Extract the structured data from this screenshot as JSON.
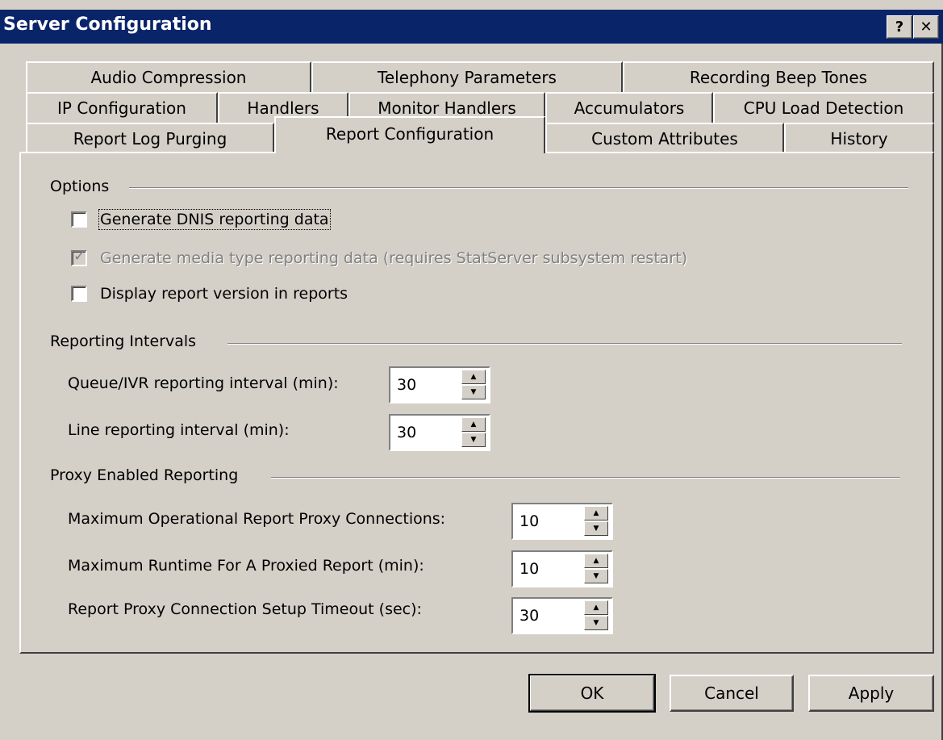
{
  "window": {
    "title": "Server Configuration",
    "help_label": "?",
    "close_label": "✕"
  },
  "tabs": {
    "row1": [
      "Audio Compression",
      "Telephony Parameters",
      "Recording Beep Tones"
    ],
    "row2": [
      "IP Configuration",
      "Handlers",
      "Monitor Handlers",
      "Accumulators",
      "CPU Load Detection"
    ],
    "row3": [
      "Report Log Purging",
      "Report Configuration",
      "Custom Attributes",
      "History"
    ],
    "active": "Report Configuration"
  },
  "options": {
    "group_label": "Options",
    "generate_dnis": {
      "label": "Generate DNIS reporting data",
      "checked": false
    },
    "generate_media": {
      "label": "Generate media type reporting data (requires StatServer subsystem restart)",
      "checked": true,
      "disabled": true
    },
    "display_version": {
      "label": "Display report version in reports",
      "checked": false
    }
  },
  "reporting_intervals": {
    "group_label": "Reporting Intervals",
    "queue_label": "Queue/IVR reporting interval (min):",
    "queue_value": "30",
    "line_label": "Line reporting interval (min):",
    "line_value": "30"
  },
  "proxy": {
    "group_label": "Proxy Enabled Reporting",
    "max_conn_label": "Maximum Operational Report Proxy Connections:",
    "max_conn_value": "10",
    "max_runtime_label": "Maximum Runtime For A Proxied Report (min):",
    "max_runtime_value": "10",
    "timeout_label": "Report Proxy Connection Setup Timeout (sec):",
    "timeout_value": "30"
  },
  "buttons": {
    "ok": "OK",
    "cancel": "Cancel",
    "apply": "Apply"
  }
}
